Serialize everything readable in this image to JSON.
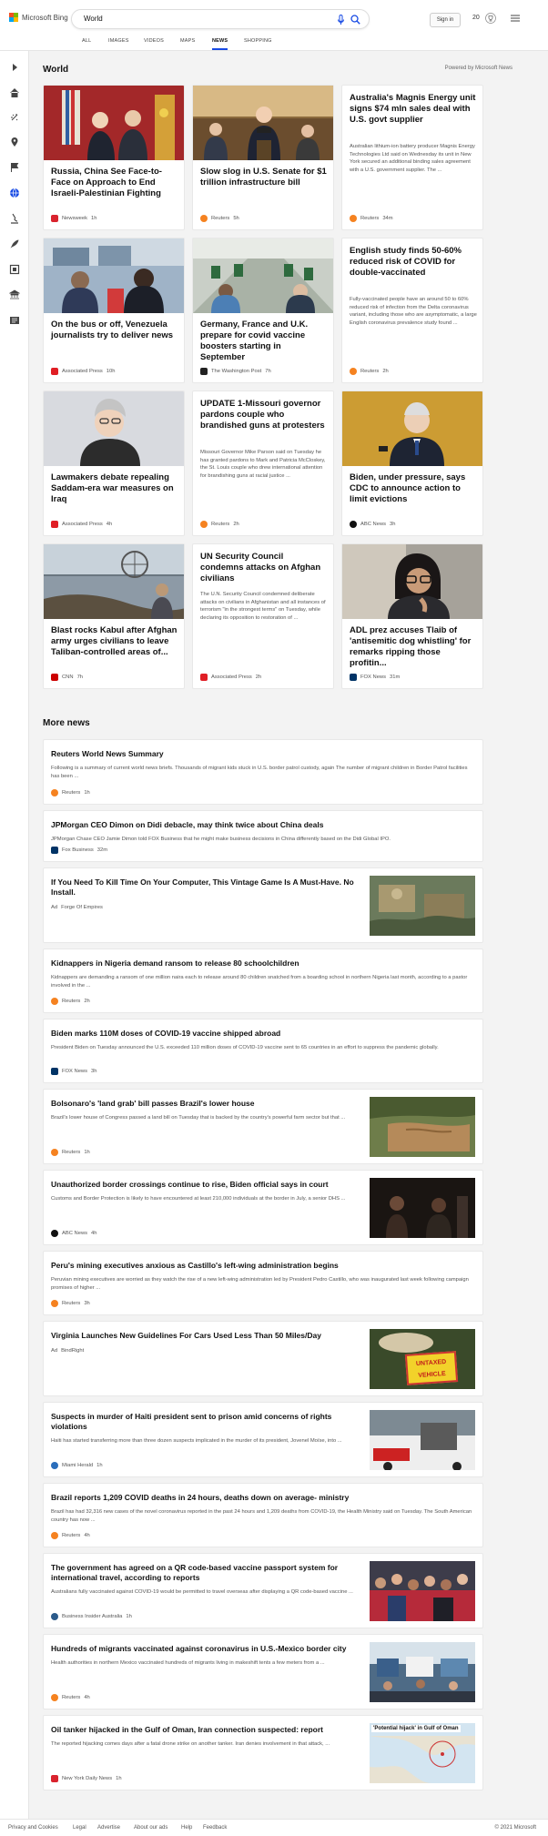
{
  "header": {
    "logo_text": "Microsoft Bing",
    "query": "World",
    "signin_label": "Sign in",
    "points": "20"
  },
  "tabs": [
    {
      "label": "ALL"
    },
    {
      "label": "IMAGES"
    },
    {
      "label": "VIDEOS"
    },
    {
      "label": "MAPS"
    },
    {
      "label": "NEWS"
    },
    {
      "label": "SHOPPING"
    }
  ],
  "section": {
    "title": "World",
    "powered": "Powered by Microsoft News"
  },
  "cards": [
    {
      "title": "Russia, China See Face-to-Face on Approach to End Israeli-Palestinian Fighting",
      "source": "Newsweek",
      "age": "1h",
      "source_color": "#d9232e"
    },
    {
      "title": "Slow slog in U.S. Senate for $1 trillion infrastructure bill",
      "source": "Reuters",
      "age": "5h",
      "source_color": "#f58220"
    },
    {
      "title": "Australia's Magnis Energy unit signs $74 mln sales deal with U.S. govt supplier",
      "snippet": "Australian lithium-ion battery producer Magnis Energy Technologies Ltd said on Wednesday its unit in New York secured an additional binding sales agreement with a U.S. government supplier. The ...",
      "source": "Reuters",
      "age": "34m",
      "source_color": "#f58220"
    },
    {
      "title": "On the bus or off, Venezuela journalists try to deliver news",
      "source": "Associated Press",
      "age": "10h",
      "source_color": "#e01e25"
    },
    {
      "title": "Germany, France and U.K. prepare for covid vaccine boosters starting in September",
      "source": "The Washington Post",
      "age": "7h",
      "source_color": "#222222"
    },
    {
      "title": "English study finds 50-60% reduced risk of COVID for double-vaccinated",
      "snippet": "Fully-vaccinated people have an around 50 to 60% reduced risk of infection from the Delta coronavirus variant, including those who are asymptomatic, a large English coronavirus prevalence study found ...",
      "source": "Reuters",
      "age": "2h",
      "source_color": "#f58220"
    },
    {
      "title": "Lawmakers debate repealing Saddam-era war measures on Iraq",
      "source": "Associated Press",
      "age": "4h",
      "source_color": "#e01e25"
    },
    {
      "title": "UPDATE 1-Missouri governor pardons couple who brandished guns at protesters",
      "snippet": "Missouri Governor Mike Parson said on Tuesday he has granted pardons to Mark and Patricia McCloskey, the St. Louis couple who drew international attention for brandishing guns at racial justice ...",
      "source": "Reuters",
      "age": "2h",
      "source_color": "#f58220"
    },
    {
      "title": "Biden, under pressure, says CDC to announce action to limit evictions",
      "source": "ABC News",
      "age": "3h",
      "source_color": "#111111"
    },
    {
      "title": "Blast rocks Kabul after Afghan army urges civilians to leave Taliban-controlled areas of...",
      "source": "CNN",
      "age": "7h",
      "source_color": "#cc0000"
    },
    {
      "title": "UN Security Council condemns attacks on Afghan civilians",
      "snippet": "The U.N. Security Council condemned deliberate attacks on civilians in Afghanistan and all instances of terrorism \"in the strongest terms\" on Tuesday, while declaring its opposition to restoration of ...",
      "source": "Associated Press",
      "age": "2h",
      "source_color": "#e01e25"
    },
    {
      "title": "ADL prez accuses Tlaib of 'antisemitic dog whistling' for remarks ripping those profitin...",
      "source": "FOX News",
      "age": "31m",
      "source_color": "#003366"
    }
  ],
  "more_news": {
    "title": "More news",
    "items": [
      {
        "title": "Reuters World News Summary",
        "snippet": "Following is a summary of current world news briefs. Thousands of migrant kids stuck in U.S. border patrol custody, again The number of migrant children in Border Patrol facilities has been ...",
        "source": "Reuters",
        "age": "1h",
        "source_color": "#f58220"
      },
      {
        "title": "JPMorgan CEO Dimon on Didi debacle, may think twice about China deals",
        "snippet": "JPMorgan Chase CEO Jamie Dimon told FOX Business that he might make business decisions in China differently based on the Didi Global IPO.",
        "source": "Fox Business",
        "age": "32m",
        "source_color": "#003366"
      },
      {
        "title": "If You Need To Kill Time On Your Computer, This Vintage Game Is A Must-Have. No Install.",
        "ad": "Ad",
        "source": "Forge Of Empires",
        "age": ""
      },
      {
        "title": "Kidnappers in Nigeria demand ransom to release 80 schoolchildren",
        "snippet": "Kidnappers are demanding a ransom of one million naira each to release around 80 children snatched from a boarding school in northern Nigeria last month, according to a pastor involved in the ...",
        "source": "Reuters",
        "age": "2h",
        "source_color": "#f58220"
      },
      {
        "title": "Biden marks 110M doses of COVID-19 vaccine shipped abroad",
        "snippet": "President Biden on Tuesday announced the U.S. exceeded 110 million doses of COVID-19 vaccine sent to 65 countries in an effort to suppress the pandemic globally.",
        "source": "FOX News",
        "age": "3h",
        "source_color": "#003366"
      },
      {
        "title": "Bolsonaro's 'land grab' bill passes Brazil's lower house",
        "snippet": "Brazil's lower house of Congress passed a land bill on Tuesday that is backed by the country's powerful farm sector but that ...",
        "source": "Reuters",
        "age": "1h",
        "source_color": "#f58220"
      },
      {
        "title": "Unauthorized border crossings continue to rise, Biden official says in court",
        "snippet": "Customs and Border Protection is likely to have encountered at least 210,000 individuals at the border in July, a senior DHS ...",
        "source": "ABC News",
        "age": "4h",
        "source_color": "#111111"
      },
      {
        "title": "Peru's mining executives anxious as Castillo's left-wing administration begins",
        "snippet": "Peruvian mining executives are worried as they watch the rise of a new left-wing administration led by President Pedro Castillo, who was inaugurated last week following campaign promises of higher ...",
        "source": "Reuters",
        "age": "3h",
        "source_color": "#f58220"
      },
      {
        "title": "Virginia Launches New Guidelines For Cars Used Less Than 50 Miles/Day",
        "ad": "Ad",
        "source": "BindRight",
        "age": "",
        "thumb_text": "UNTAXED VEHICLE"
      },
      {
        "title": "Suspects in murder of Haiti president sent to prison amid concerns of rights violations",
        "snippet": "Haiti has started transferring more than three dozen suspects implicated in the murder of its president, Jovenel Moïse, into ...",
        "source": "Miami Herald",
        "age": "1h",
        "source_color": "#2a6ebb"
      },
      {
        "title": "Brazil reports 1,209 COVID deaths in 24 hours, deaths down on average- ministry",
        "snippet": "Brazil has had 32,316 new cases of the novel coronavirus reported in the past 24 hours and 1,209 deaths from COVID-19, the Health Ministry said on Tuesday. The South American country has now ...",
        "source": "Reuters",
        "age": "4h",
        "source_color": "#f58220"
      },
      {
        "title": "The government has agreed on a QR code-based vaccine passport system for international travel, according to reports",
        "snippet": "Australians fully vaccinated against COVID-19 would be permitted to travel overseas after displaying a QR code-based vaccine ...",
        "source": "Business Insider Australia",
        "age": "1h",
        "source_color": "#2b5a8a"
      },
      {
        "title": "Hundreds of migrants vaccinated against coronavirus in U.S.-Mexico border city",
        "snippet": "Health authorities in northern Mexico vaccinated hundreds of migrants living in makeshift tents a few meters from a ...",
        "source": "Reuters",
        "age": "4h",
        "source_color": "#f58220"
      },
      {
        "title": "Oil tanker hijacked in the Gulf of Oman, Iran connection suspected: report",
        "snippet": "The reported hijacking comes days after a fatal drone strike on another tanker. Iran denies involvement in that attack, ...",
        "source": "New York Daily News",
        "age": "1h",
        "source_color": "#d9232e",
        "thumb_text": "'Potential hijack' in Gulf of Oman"
      }
    ]
  },
  "footer": {
    "links": [
      "Privacy and Cookies",
      "Legal",
      "Advertise",
      "About our ads",
      "Help",
      "Feedback"
    ],
    "copyright": "© 2021 Microsoft"
  },
  "colors": {
    "accent": "#174ae4",
    "bing_teal": "#008373"
  },
  "icons": [
    "chevron-right-icon",
    "home-icon",
    "sparkle-icon",
    "location-icon",
    "flag-icon",
    "globe-icon",
    "microscope-icon",
    "rocket-icon",
    "film-icon",
    "bank-icon",
    "news-icon",
    "microphone-icon",
    "search-icon",
    "trophy-icon",
    "hamburger-icon"
  ]
}
